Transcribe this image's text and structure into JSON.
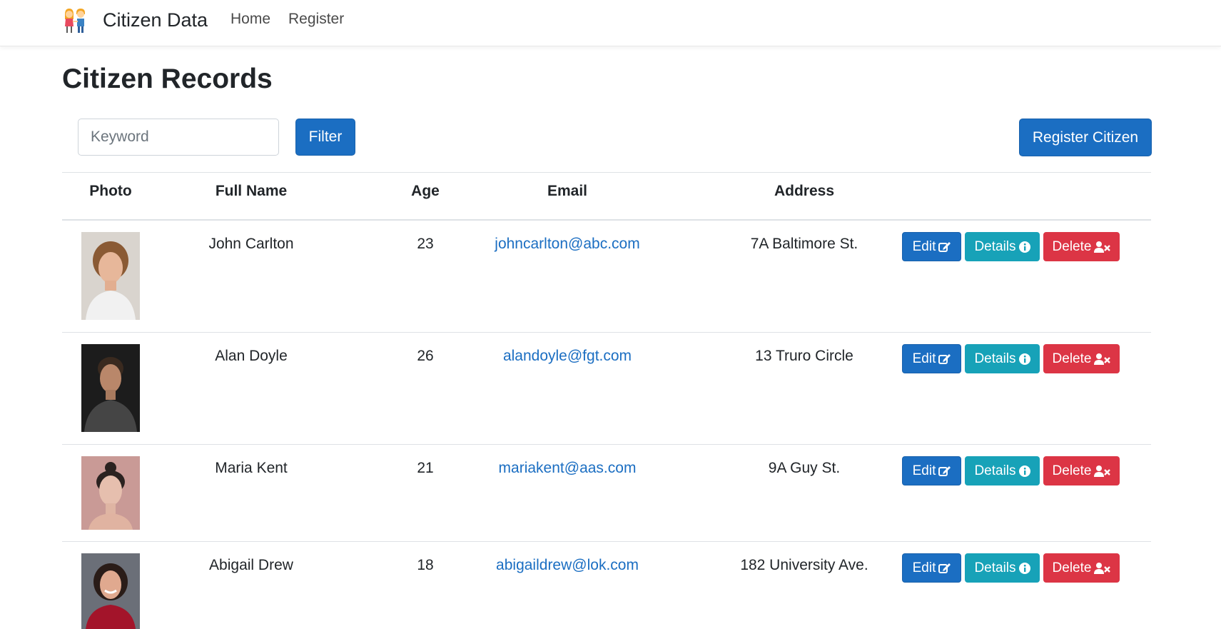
{
  "navbar": {
    "brand": "Citizen Data",
    "brand_icon": "people-holding-hands-icon",
    "links": [
      {
        "label": "Home"
      },
      {
        "label": "Register"
      }
    ]
  },
  "page": {
    "title": "Citizen Records"
  },
  "filter": {
    "keyword_placeholder": "Keyword",
    "keyword_value": "",
    "filter_label": "Filter",
    "register_label": "Register Citizen"
  },
  "table": {
    "headers": [
      "Photo",
      "Full Name",
      "Age",
      "Email",
      "Address"
    ],
    "rows": [
      {
        "name": "John Carlton",
        "age": "23",
        "email": "johncarlton@abc.com",
        "address": "7A Baltimore St."
      },
      {
        "name": "Alan Doyle",
        "age": "26",
        "email": "alandoyle@fgt.com",
        "address": "13 Truro Circle"
      },
      {
        "name": "Maria Kent",
        "age": "21",
        "email": "mariakent@aas.com",
        "address": "9A Guy St."
      },
      {
        "name": "Abigail Drew",
        "age": "18",
        "email": "abigaildrew@lok.com",
        "address": "182 University Ave."
      }
    ],
    "actions": {
      "edit": "Edit",
      "details": "Details",
      "delete": "Delete"
    }
  },
  "colors": {
    "primary": "#1b6ec2",
    "info": "#17a2b8",
    "danger": "#dc3545",
    "text": "#212529",
    "border": "#dee2e6"
  }
}
